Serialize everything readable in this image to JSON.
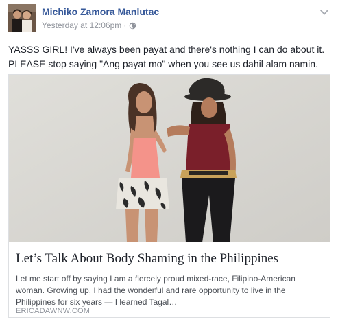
{
  "post": {
    "author": "Michiko Zamora Manlutac",
    "timestamp": "Yesterday at 12:06pm",
    "separator": "·",
    "audience_icon": "globe-icon",
    "options_icon": "chevron-down-icon",
    "text_lines": [
      "YASSS GIRL! I've always been payat and there's nothing I can do about it.",
      "PLEASE stop saying \"Ang payat mo\" when you see us dahil alam namin."
    ]
  },
  "link_card": {
    "title": "Let’s Talk About Body Shaming in the Philippines",
    "description_lines": [
      "Let me start off by saying I am a fiercely proud mixed-race, Filipino-American",
      "woman. Growing up, I had the wonderful and rare opportunity to live in the",
      "Philippines for six years — I learned Tagal…"
    ],
    "domain": "ERICADAWNW.COM"
  },
  "colors": {
    "author_link": "#365899",
    "meta_text": "#90949c",
    "body_text": "#1d2129",
    "card_border": "#dddfe2"
  }
}
